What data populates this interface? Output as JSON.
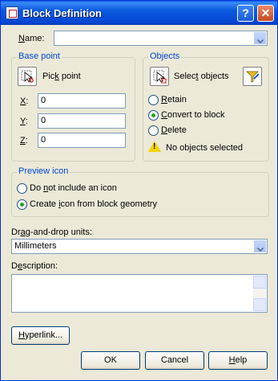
{
  "window": {
    "title": "Block Definition"
  },
  "titlebar": {
    "help_glyph": "?",
    "close_glyph": "✕"
  },
  "name": {
    "label_pre": "",
    "label_key": "N",
    "label_post": "ame:",
    "value": ""
  },
  "base_point": {
    "title": "Base point",
    "pick_label_pre": "Pic",
    "pick_label_key": "k",
    "pick_label_post": " point",
    "x_key": "X",
    "x_value": "0",
    "y_key": "Y",
    "y_value": "0",
    "z_key": "Z",
    "z_value": "0",
    "colon": ":"
  },
  "objects": {
    "title": "Objects",
    "select_label_pre": "Selec",
    "select_label_key": "t",
    "select_label_post": " objects",
    "retain_key": "R",
    "retain_rest": "etain",
    "convert_pre": "",
    "convert_key": "C",
    "convert_post": "onvert to block",
    "delete_key": "D",
    "delete_rest": "elete",
    "selected": "convert",
    "status": "No objects selected"
  },
  "preview_icon": {
    "title": "Preview icon",
    "opt1_pre": "Do ",
    "opt1_key": "n",
    "opt1_post": "ot include an icon",
    "opt2_pre": "Create ",
    "opt2_key": "i",
    "opt2_post": "con from block geometry",
    "selected": "create"
  },
  "units": {
    "label_pre": "Dr",
    "label_key": "a",
    "label_post": "g-and-drop units:",
    "value": "Millimeters"
  },
  "description": {
    "label_pre": "D",
    "label_key": "e",
    "label_post": "scription:",
    "value": ""
  },
  "buttons": {
    "hyperlink_pre": "",
    "hyperlink_key": "H",
    "hyperlink_post": "yperlink...",
    "ok": "OK",
    "cancel": "Cancel",
    "help_pre": "",
    "help_key": "H",
    "help_post": "elp"
  }
}
